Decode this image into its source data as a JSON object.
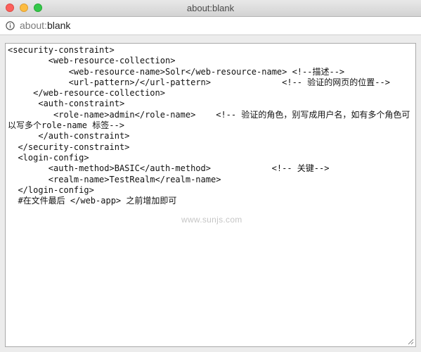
{
  "window": {
    "title": "about:blank"
  },
  "address_bar": {
    "scheme": "about:",
    "rest": "blank",
    "info_icon": "info-icon"
  },
  "textarea": {
    "lines": [
      "<security-constraint>",
      "        <web-resource-collection>",
      "            <web-resource-name>Solr</web-resource-name> <!--描述-->",
      "            <url-pattern>/</url-pattern>              <!-- 验证的网页的位置-->",
      "     </web-resource-collection>",
      "      <auth-constraint>",
      "         <role-name>admin</role-name>    <!-- 验证的角色，别写成用户名，如有多个角色可以写多个role-name 标签-->",
      "      </auth-constraint>",
      "  </security-constraint>",
      "  <login-config>",
      "        <auth-method>BASIC</auth-method>            <!-- 关键-->",
      "        <realm-name>TestRealm</realm-name>",
      "  </login-config>",
      "  #在文件最后 </web-app> 之前增加即可"
    ],
    "watermark": "www.sunjs.com"
  }
}
